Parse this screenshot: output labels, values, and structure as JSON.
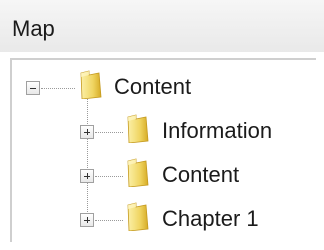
{
  "panel": {
    "title": "Map"
  },
  "tree": {
    "root": {
      "label": "Content",
      "expanded": true,
      "icon": "folder-icon"
    },
    "children": [
      {
        "label": "Information",
        "expanded": false,
        "icon": "folder-icon"
      },
      {
        "label": "Content",
        "expanded": false,
        "icon": "folder-icon"
      },
      {
        "label": "Chapter 1",
        "expanded": false,
        "icon": "folder-icon"
      }
    ]
  },
  "colors": {
    "folder_light": "#f3e07a",
    "folder_dark": "#d9b52e",
    "header_bg": "#eeeeee",
    "border": "#cfcfcf"
  }
}
